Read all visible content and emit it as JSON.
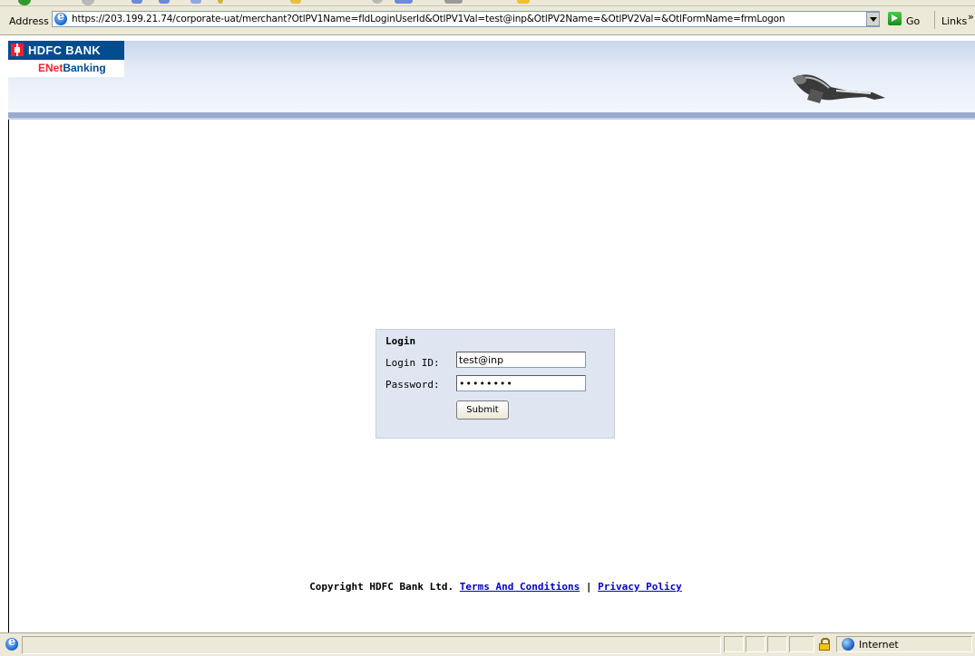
{
  "browser": {
    "address_label": "Address",
    "url": "https://203.199.21.74/corporate-uat/merchant?OtlPV1Name=fldLoginUserId&OtlPV1Val=test@inp&OtlPV2Name=&OtlPV2Val=&OtlFormName=frmLogon",
    "go_label": "Go",
    "links_label": "Links",
    "links_chevron": "»"
  },
  "header": {
    "logo_bank": "HDFC BANK",
    "logo_enet_prefix": "ENet",
    "logo_enet_suffix": "Banking"
  },
  "login": {
    "title": "Login",
    "login_id_label": "Login ID:",
    "login_id_value": "test@inp",
    "password_label": "Password:",
    "password_value": "••••••••",
    "submit_label": "Submit"
  },
  "footer": {
    "copyright": "Copyright HDFC Bank Ltd.",
    "terms": "Terms And Conditions",
    "separator": "|",
    "privacy": "Privacy Policy"
  },
  "status_bar": {
    "zone": "Internet"
  },
  "colors": {
    "brand_blue": "#004c8f",
    "brand_red": "#ed232a",
    "link_blue": "#0000cc",
    "login_panel_bg": "#dfe6f1"
  },
  "icons": [
    "ie-page-icon",
    "go-arrow-icon",
    "dropdown-arrow-icon",
    "hdfc-logo-icon",
    "keys-icon",
    "lock-icon",
    "internet-zone-icon"
  ]
}
